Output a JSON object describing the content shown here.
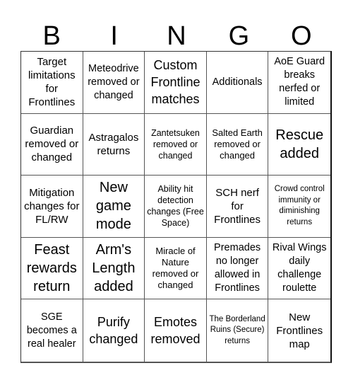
{
  "header": {
    "letters": [
      "B",
      "I",
      "N",
      "G",
      "O"
    ]
  },
  "cells": [
    {
      "text": "Target limitations for Frontlines"
    },
    {
      "text": "Meteodrive removed or changed"
    },
    {
      "text": "Custom Frontline matches"
    },
    {
      "text": "Additionals"
    },
    {
      "text": "AoE Guard breaks nerfed or limited"
    },
    {
      "text": "Guardian removed or changed"
    },
    {
      "text": "Astragalos returns"
    },
    {
      "text": "Zantetsuken removed or changed"
    },
    {
      "text": "Salted Earth removed or changed"
    },
    {
      "text": "Rescue added"
    },
    {
      "text": "Mitigation changes for FL/RW"
    },
    {
      "text": "New game mode"
    },
    {
      "text": "Ability hit detection changes (Free Space)"
    },
    {
      "text": "SCH nerf for Frontlines"
    },
    {
      "text": "Crowd control immunity or diminishing returns"
    },
    {
      "text": "Feast rewards return"
    },
    {
      "text": "Arm's Length added"
    },
    {
      "text": "Miracle of Nature removed or changed"
    },
    {
      "text": "Premades no longer allowed in Frontlines"
    },
    {
      "text": "Rival Wings daily challenge roulette"
    },
    {
      "text": "SGE becomes a real healer"
    },
    {
      "text": "Purify changed"
    },
    {
      "text": "Emotes removed"
    },
    {
      "text": "The Borderland Ruins (Secure) returns"
    },
    {
      "text": "New Frontlines map"
    }
  ]
}
